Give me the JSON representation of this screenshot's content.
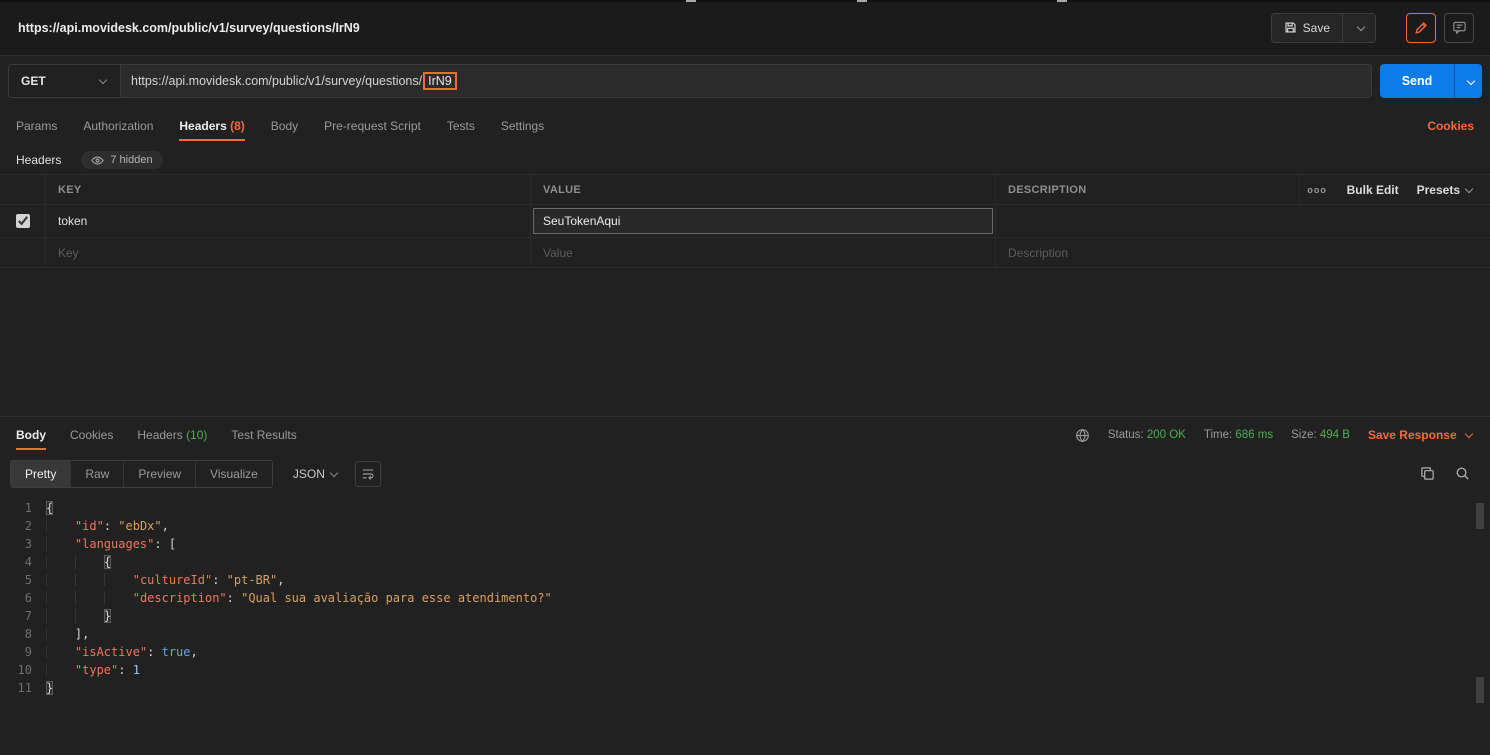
{
  "topbar": {
    "tab_title": "https://api.movidesk.com/public/v1/survey/questions/IrN9",
    "save_label": "Save"
  },
  "request": {
    "method": "GET",
    "url_prefix": "https://api.movidesk.com/public/v1/survey/questions/",
    "url_highlight": "IrN9",
    "send_label": "Send"
  },
  "request_tabs": {
    "params": "Params",
    "authorization": "Authorization",
    "headers": "Headers",
    "headers_count": "(8)",
    "body": "Body",
    "prerequest": "Pre-request Script",
    "tests": "Tests",
    "settings": "Settings",
    "cookies_link": "Cookies"
  },
  "headers_section": {
    "title": "Headers",
    "hidden_badge": "7 hidden",
    "columns": {
      "key": "KEY",
      "value": "VALUE",
      "description": "DESCRIPTION"
    },
    "more_options": "ooo",
    "bulk_edit": "Bulk Edit",
    "presets": "Presets",
    "rows": [
      {
        "key": "token",
        "value": "SeuTokenAqui",
        "description": ""
      }
    ],
    "placeholder_row": {
      "key": "Key",
      "value": "Value",
      "description": "Description"
    }
  },
  "response": {
    "tabs": {
      "body": "Body",
      "cookies": "Cookies",
      "headers": "Headers",
      "headers_count": "(10)",
      "test_results": "Test Results"
    },
    "status_label": "Status:",
    "status_value": "200 OK",
    "time_label": "Time:",
    "time_value": "686 ms",
    "size_label": "Size:",
    "size_value": "494 B",
    "save_response": "Save Response",
    "view_tabs": {
      "pretty": "Pretty",
      "raw": "Raw",
      "preview": "Preview",
      "visualize": "Visualize"
    },
    "format": "JSON"
  },
  "response_body": {
    "lines": [
      [
        [
          "brm",
          "{"
        ]
      ],
      [
        [
          "ind",
          "    "
        ],
        [
          "key",
          "\"id\""
        ],
        [
          "pun",
          ": "
        ],
        [
          "str",
          "\"ebDx\""
        ],
        [
          "pun",
          ","
        ]
      ],
      [
        [
          "ind",
          "    "
        ],
        [
          "key",
          "\"languages\""
        ],
        [
          "pun",
          ": ["
        ]
      ],
      [
        [
          "ind",
          "    "
        ],
        [
          "ind",
          "    "
        ],
        [
          "brm",
          "{"
        ]
      ],
      [
        [
          "ind",
          "    "
        ],
        [
          "ind",
          "    "
        ],
        [
          "ind",
          "    "
        ],
        [
          "key",
          "\"cultureId\""
        ],
        [
          "pun",
          ": "
        ],
        [
          "str",
          "\"pt-BR\""
        ],
        [
          "pun",
          ","
        ]
      ],
      [
        [
          "ind",
          "    "
        ],
        [
          "ind",
          "    "
        ],
        [
          "ind",
          "    "
        ],
        [
          "key",
          "\"description\""
        ],
        [
          "pun",
          ": "
        ],
        [
          "str",
          "\"Qual sua avaliação para esse atendimento?\""
        ]
      ],
      [
        [
          "ind",
          "    "
        ],
        [
          "ind",
          "    "
        ],
        [
          "brm",
          "}"
        ]
      ],
      [
        [
          "ind",
          "    "
        ],
        [
          "pun",
          "],"
        ]
      ],
      [
        [
          "ind",
          "    "
        ],
        [
          "key",
          "\"isActive\""
        ],
        [
          "pun",
          ": "
        ],
        [
          "bool",
          "true"
        ],
        [
          "pun",
          ","
        ]
      ],
      [
        [
          "ind",
          "    "
        ],
        [
          "key",
          "\"type\""
        ],
        [
          "pun",
          ": "
        ],
        [
          "num",
          "1"
        ]
      ],
      [
        [
          "brm",
          "}"
        ]
      ]
    ]
  },
  "colors": {
    "accent_orange": "#f26b3a",
    "send_blue": "#0d7be8",
    "success_green": "#4caf50"
  }
}
